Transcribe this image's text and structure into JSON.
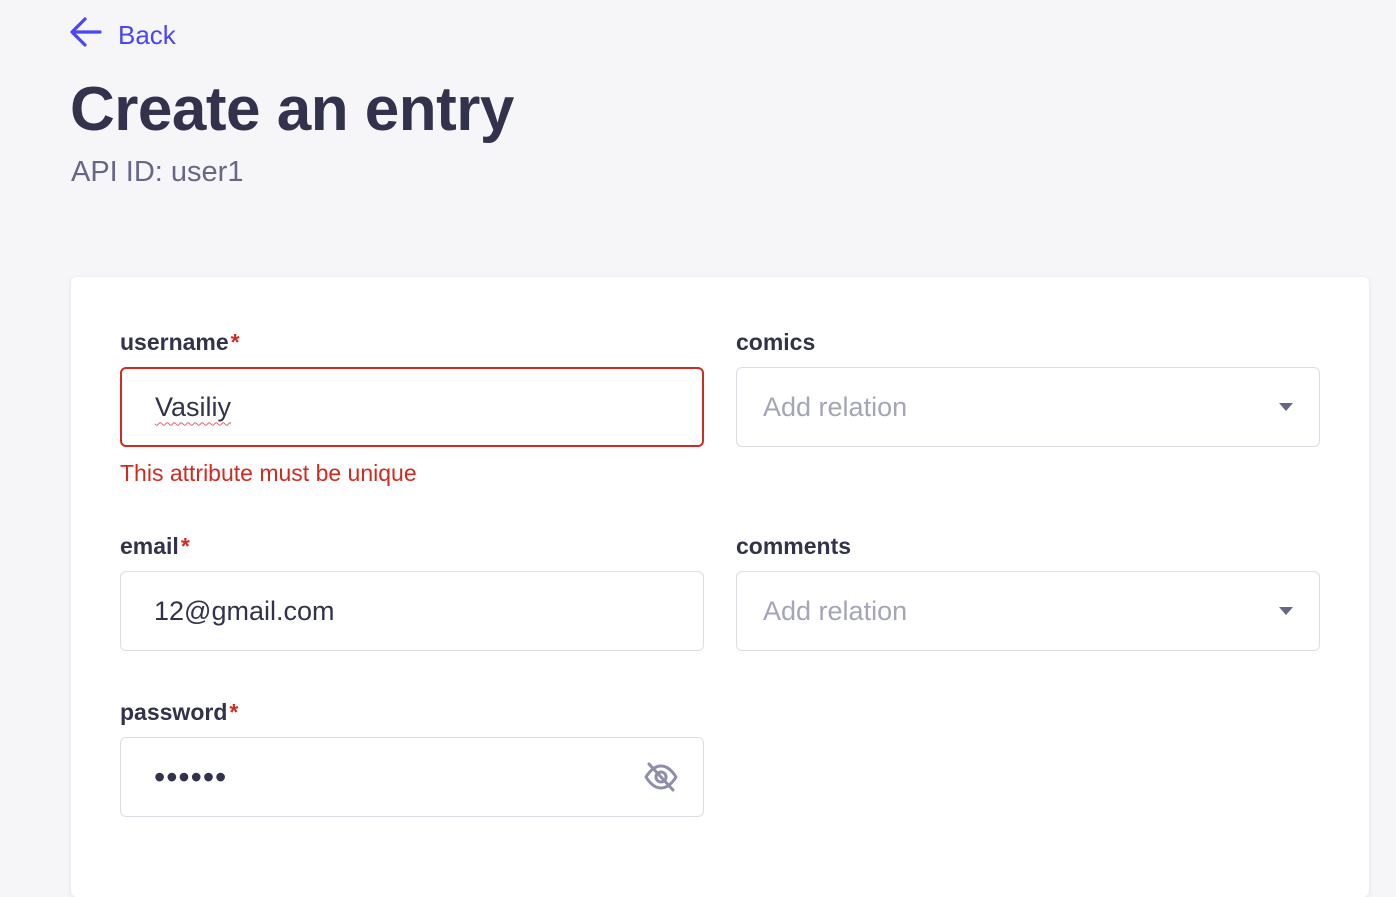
{
  "nav": {
    "back_label": "Back"
  },
  "header": {
    "title": "Create an entry",
    "subtitle": "API ID: user1"
  },
  "form": {
    "username": {
      "label": "username",
      "required_mark": "*",
      "value": "Vasiliy",
      "error": "This attribute must be unique"
    },
    "email": {
      "label": "email",
      "required_mark": "*",
      "value": "12@gmail.com"
    },
    "password": {
      "label": "password",
      "required_mark": "*",
      "value": "••••••"
    },
    "comics": {
      "label": "comics",
      "placeholder": "Add relation"
    },
    "comments": {
      "label": "comments",
      "placeholder": "Add relation"
    }
  },
  "icons": {
    "back": "arrow-left-icon",
    "select_caret": "caret-down-icon",
    "password_toggle": "eye-off-icon"
  },
  "colors": {
    "accent": "#4945ff",
    "error": "#d02b20",
    "text": "#32324d",
    "muted": "#666687",
    "background": "#f6f6f9"
  }
}
